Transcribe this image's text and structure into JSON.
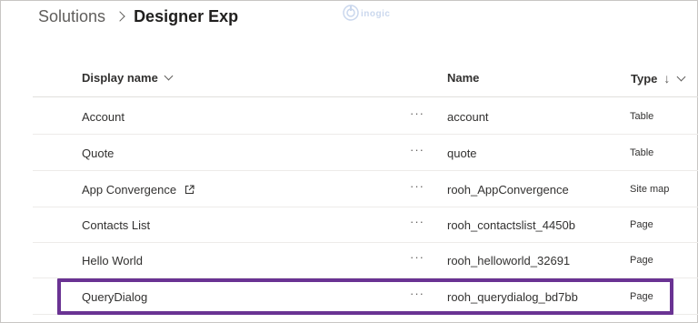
{
  "breadcrumb": {
    "root": "Solutions",
    "current": "Designer Exp"
  },
  "watermark": {
    "text": "inogic",
    "icon": "inogic-logo-icon"
  },
  "table": {
    "columns": {
      "display_name": "Display name",
      "name": "Name",
      "type": "Type",
      "type_sort": "↓"
    },
    "rows": [
      {
        "display_name": "Account",
        "more": "···",
        "name": "account",
        "type": "Table"
      },
      {
        "display_name": "Quote",
        "more": "···",
        "name": "quote",
        "type": "Table"
      },
      {
        "display_name": "App Convergence",
        "more": "···",
        "name": "rooh_AppConvergence",
        "type": "Site map",
        "icon": "open-external-icon"
      },
      {
        "display_name": "Contacts List",
        "more": "···",
        "name": "rooh_contactslist_4450b",
        "type": "Page"
      },
      {
        "display_name": "Hello World",
        "more": "···",
        "name": "rooh_helloworld_32691",
        "type": "Page"
      },
      {
        "display_name": "QueryDialog",
        "more": "···",
        "name": "rooh_querydialog_bd7bb",
        "type": "Page"
      }
    ]
  },
  "colors": {
    "highlight": "#6a3393",
    "text": "#323130",
    "divider": "#edebe9"
  }
}
